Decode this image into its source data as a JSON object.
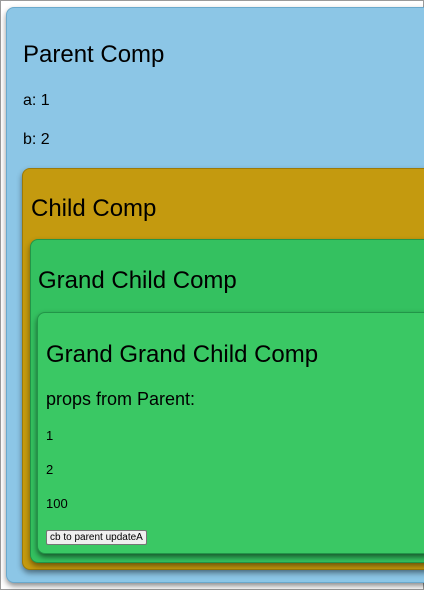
{
  "parent": {
    "title": "Parent Comp",
    "a_text": "a: 1",
    "b_text": "b: 2"
  },
  "child": {
    "title": "Child Comp"
  },
  "grand_child": {
    "title": "Grand Child Comp"
  },
  "grand_grand_child": {
    "title": "Grand Grand Child Comp",
    "props_label": "props from Parent:",
    "values": [
      "1",
      "2",
      "100"
    ],
    "button_label": "cb to parent updateA"
  },
  "colors": {
    "parent_bg": "#8cc6e6",
    "child_bg": "#c49a0f",
    "grand_child_bg": "#34c160",
    "grand_grand_child_bg": "#3ac864"
  }
}
